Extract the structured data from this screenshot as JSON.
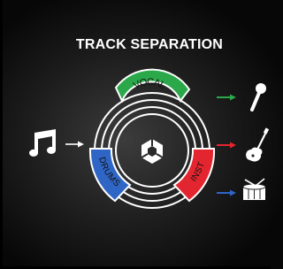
{
  "title": "TRACK SEPARATION",
  "input": {
    "icon": "music-note-icon"
  },
  "ring": {
    "center_icon": "hexagon-logo-icon",
    "segments": [
      {
        "label": "VOCAL",
        "color": "#2aa84a"
      },
      {
        "label": "DRUMS",
        "color": "#2f66c6"
      },
      {
        "label": "INST",
        "color": "#e3252f"
      }
    ]
  },
  "outputs": [
    {
      "arrow_color": "#2aa84a",
      "icon": "microphone-icon"
    },
    {
      "arrow_color": "#e3252f",
      "icon": "electric-guitar-icon"
    },
    {
      "arrow_color": "#2f66c6",
      "icon": "snare-drum-icon"
    }
  ],
  "colors": {
    "input_arrow": "#ffffff",
    "ring_line": "#ffffff",
    "background": "#1d1d1d"
  }
}
